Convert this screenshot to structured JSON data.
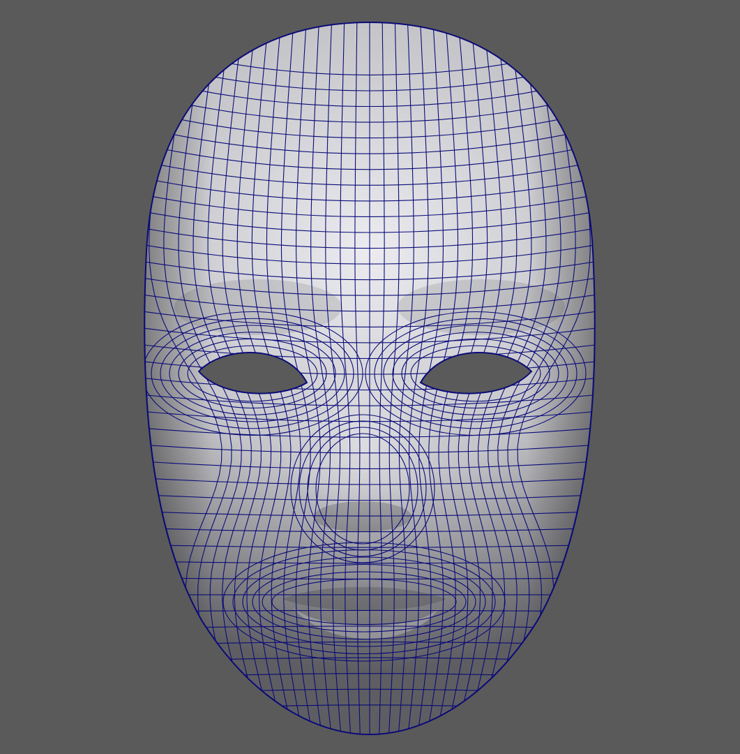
{
  "viewport": {
    "background_color": "#5a5a5a",
    "shading": "smooth",
    "wireframe_on_shaded": true
  },
  "mesh": {
    "object": "face-mask",
    "surface_color": "#c4c4c8",
    "highlight_color": "#ececf0",
    "shadow_color": "#5e5e62",
    "wireframe_color": "#0a0a78",
    "hole_color": "#5a5a5a"
  }
}
